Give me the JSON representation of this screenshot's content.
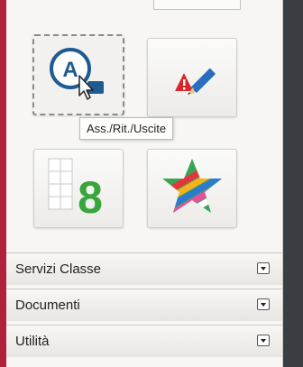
{
  "tooltip": {
    "text": "Ass./Rit./Uscite"
  },
  "tiles": [
    {
      "icon": "attendance-cursor-icon"
    },
    {
      "icon": "pencil-warning-icon"
    },
    {
      "icon": "grade-eight-icon",
      "grade": "8"
    },
    {
      "icon": "colorful-star-icon"
    }
  ],
  "sections": [
    {
      "label": "Servizi Classe"
    },
    {
      "label": "Documenti"
    },
    {
      "label": "Utilità"
    }
  ],
  "colors": {
    "accent_red": "#b0213a",
    "icon_blue": "#1e5b92",
    "grade_green": "#37a63c"
  }
}
